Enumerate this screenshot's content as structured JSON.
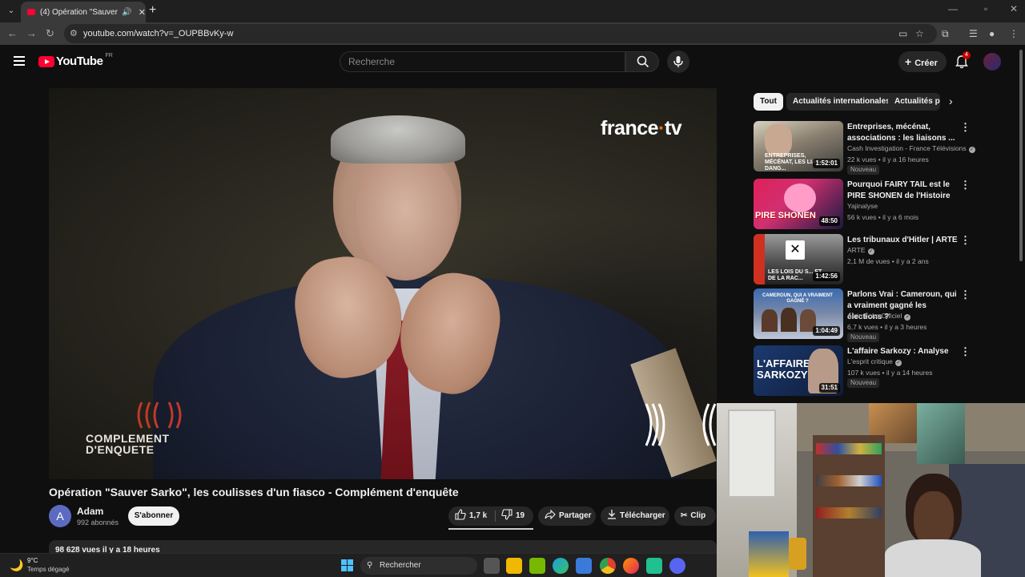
{
  "browser": {
    "tab_title": "(4) Opération \"Sauver Sarko",
    "url": "youtube.com/watch?v=_OUPBBvKy-w",
    "new_tab": "+",
    "close_tab": "✕"
  },
  "youtube": {
    "logo_word": "YouTube",
    "region": "FR",
    "search_placeholder": "Recherche",
    "create_label": "Créer",
    "notifications_count": "4"
  },
  "player": {
    "watermark": "france·tv",
    "watermark_main": "france",
    "watermark_dot": "·",
    "watermark_tail": "tv",
    "show_logo_line1": "COMPLEMENT",
    "show_logo_line2": "D'ENQUETE"
  },
  "video": {
    "title": "Opération \"Sauver Sarko\", les coulisses d'un fiasco - Complément d'enquête",
    "channel_initial": "A",
    "channel_name": "Adam",
    "channel_subs": "992 abonnés",
    "subscribe_label": "S'abonner",
    "likes": "1,7 k",
    "dislikes": "19",
    "share_label": "Partager",
    "download_label": "Télécharger",
    "clip_label": "Clip",
    "description_preview": "98 628 vues  il y a 18 heures"
  },
  "sidebar": {
    "chips": [
      "Tout",
      "Actualités internationales",
      "Actualités po"
    ],
    "recommendations": [
      {
        "title": "Entreprises, mécénat, associations : les liaisons ...",
        "channel": "Cash Investigation - France Télévisions",
        "verified": true,
        "views": "22 k vues",
        "age": "il y a 16 heures",
        "duration": "1:52:01",
        "badge": "Nouveau",
        "thumb_text": "ENTREPRISES, MÉCÉNAT, LES LIAISONS DANG...",
        "thumb_colors": [
          "#d8d0c0",
          "#3a3a3a"
        ]
      },
      {
        "title": "Pourquoi FAIRY TAIL est le PIRE SHONEN de l'Histoire",
        "channel": "Yajinalyse",
        "verified": false,
        "views": "56 k vues",
        "age": "il y a 6 mois",
        "duration": "48:50",
        "badge": "",
        "thumb_text": "PIRE SHONEN",
        "thumb_colors": [
          "#e0205a",
          "#1a1a40"
        ]
      },
      {
        "title": "Les tribunaux d'Hitler | ARTE",
        "channel": "ARTE",
        "verified": true,
        "views": "2,1 M de vues",
        "age": "il y a 2 ans",
        "duration": "1:42:56",
        "badge": "",
        "thumb_text": "LES LOIS DU S... ET DE LA RAC...",
        "thumb_colors": [
          "#7a7a7a",
          "#2a2a2a"
        ]
      },
      {
        "title": "Parlons Vrai : Cameroun, qui a vraiment gagné les élections ?",
        "channel": "Alain Foka Officiel",
        "verified": true,
        "views": "6,7 k vues",
        "age": "il y a 3 heures",
        "duration": "1:04:49",
        "badge": "Nouveau",
        "thumb_text": "CAMEROUN, QUI A VRAIMENT GAGNÉ ?",
        "thumb_colors": [
          "#3a6ab0",
          "#c0c8d8"
        ]
      },
      {
        "title": "L'affaire Sarkozy : Analyse",
        "channel": "L'esprit critique",
        "verified": true,
        "views": "107 k vues",
        "age": "il y a 14 heures",
        "duration": "31:51",
        "badge": "Nouveau",
        "thumb_text": "L'AFFAIRE SARKOZY",
        "thumb_colors": [
          "#1c3a70",
          "#0e1c38"
        ]
      }
    ]
  },
  "taskbar": {
    "temperature": "9°C",
    "weather": "Temps dégagé",
    "search_label": "Rechercher"
  }
}
